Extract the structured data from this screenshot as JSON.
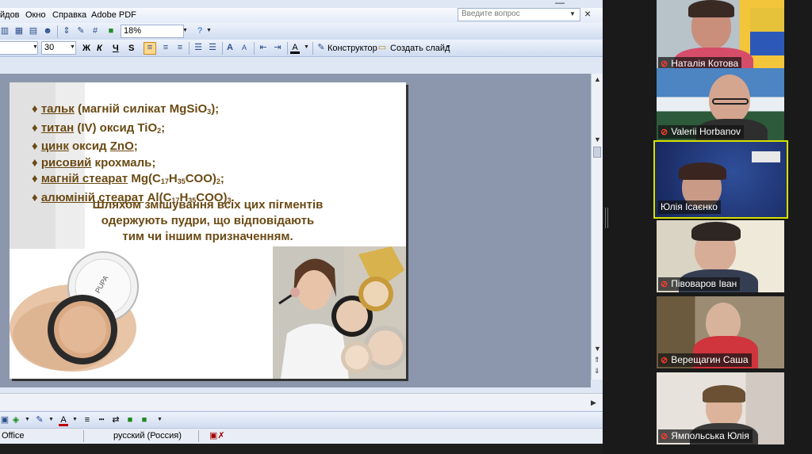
{
  "powerpoint": {
    "menu": [
      "йдов",
      "Окно",
      "Справка",
      "Adobe PDF"
    ],
    "help_placeholder": "Введите вопрос",
    "close_glyph": "×",
    "minimize_glyph": "—",
    "zoom_value": "18%",
    "font_size": "30",
    "format_buttons": [
      "Ж",
      "К",
      "Ч",
      "S"
    ],
    "designer_button": "Конструктор",
    "new_slide_button": "Создать слайд",
    "status_office": "Office",
    "status_language": "русский (Россия)"
  },
  "slide": {
    "bullet_glyph": "♦",
    "bullets": [
      {
        "u": "тальк",
        "rest": " (магній силікат MgSiO",
        "sub": "3",
        "tail": ");"
      },
      {
        "u": "титан",
        "rest": " (IV) оксид TiO",
        "sub": "2",
        "tail": ";"
      },
      {
        "u": "цинк",
        "rest": " оксид ",
        "u2": "ZnO",
        "tail": ";"
      },
      {
        "u": "рисовий",
        "rest": " крохмаль;"
      },
      {
        "u": "магній стеарат",
        "rest": " Mg(C",
        "sub": "17",
        "mid": "H",
        "sub2": "35",
        "tail": "COO)",
        "sub3": "2",
        "end": ";"
      },
      {
        "u": "алюміній стеарат",
        "rest": " Al(C",
        "sub": "17",
        "mid": "H",
        "sub2": "35",
        "tail": "COO)",
        "sub3": "3",
        "end": "."
      }
    ],
    "summary": [
      "Шляхом змішування всіх цих пігментів",
      "одержують пудри, що відповідають",
      "тим чи іншим призначенням."
    ],
    "compact_brand": "PUPA"
  },
  "participants": [
    {
      "name": "Наталія Котова",
      "muted": true,
      "speaking": false
    },
    {
      "name": "Valerii Horbanov",
      "muted": true,
      "speaking": false
    },
    {
      "name": "Юлія Ісаєнко",
      "muted": false,
      "speaking": true
    },
    {
      "name": "Пiвоваров Iван",
      "muted": true,
      "speaking": false
    },
    {
      "name": "Верещагин Саша",
      "muted": true,
      "speaking": false
    },
    {
      "name": "Ямпольська Юлія",
      "muted": true,
      "speaking": false
    }
  ],
  "colors": {
    "speaking_border": "#d6e000",
    "slide_text": "#6b4a14",
    "muted_icon": "#ff3b30"
  }
}
